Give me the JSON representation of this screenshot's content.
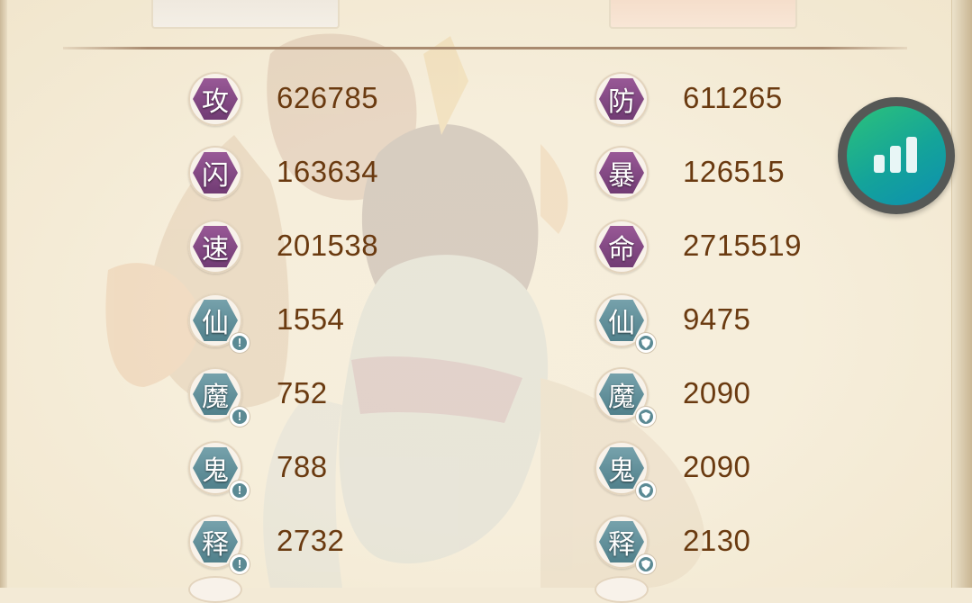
{
  "tabs": {
    "left_title": "",
    "right_title": ""
  },
  "stats_left": [
    {
      "icon_char": "攻",
      "value": "626785",
      "style": "purple",
      "sub_icon": ""
    },
    {
      "icon_char": "闪",
      "value": "163634",
      "style": "purple",
      "sub_icon": ""
    },
    {
      "icon_char": "速",
      "value": "201538",
      "style": "purple",
      "sub_icon": ""
    },
    {
      "icon_char": "仙",
      "value": "1554",
      "style": "teal",
      "sub_icon": "!"
    },
    {
      "icon_char": "魔",
      "value": "752",
      "style": "teal",
      "sub_icon": "!"
    },
    {
      "icon_char": "鬼",
      "value": "788",
      "style": "teal",
      "sub_icon": "!"
    },
    {
      "icon_char": "释",
      "value": "2732",
      "style": "teal",
      "sub_icon": "!"
    }
  ],
  "stats_right": [
    {
      "icon_char": "防",
      "value": "611265",
      "style": "purple",
      "sub_icon": ""
    },
    {
      "icon_char": "暴",
      "value": "126515",
      "style": "purple",
      "sub_icon": ""
    },
    {
      "icon_char": "命",
      "value": "2715519",
      "style": "purple",
      "sub_icon": ""
    },
    {
      "icon_char": "仙",
      "value": "9475",
      "style": "teal",
      "sub_icon": "shield"
    },
    {
      "icon_char": "魔",
      "value": "2090",
      "style": "teal",
      "sub_icon": "shield"
    },
    {
      "icon_char": "鬼",
      "value": "2090",
      "style": "teal",
      "sub_icon": "shield"
    },
    {
      "icon_char": "释",
      "value": "2130",
      "style": "teal",
      "sub_icon": "shield"
    }
  ],
  "floating_button": {
    "icon": "bar-chart-icon",
    "colors": [
      "#2cc27a",
      "#0d8fb1"
    ]
  },
  "colors": {
    "value_text": "#6a3a10",
    "purple_badge": "#7e4580",
    "teal_badge": "#5b8a94",
    "background": "#f6eedb"
  }
}
